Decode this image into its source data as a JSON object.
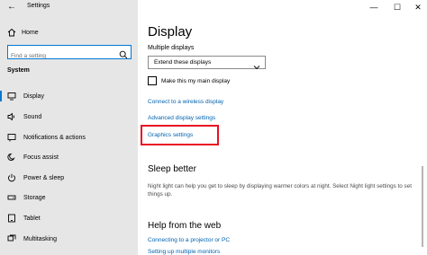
{
  "window": {
    "title": "Settings",
    "back_glyph": "←",
    "minimize_glyph": "—",
    "maximize_glyph": "☐",
    "close_glyph": "✕"
  },
  "sidebar": {
    "home_label": "Home",
    "search_placeholder": "Find a setting",
    "section_label": "System",
    "items": [
      {
        "label": "Display",
        "icon": "display-icon",
        "active": true
      },
      {
        "label": "Sound",
        "icon": "sound-icon"
      },
      {
        "label": "Notifications & actions",
        "icon": "notifications-icon"
      },
      {
        "label": "Focus assist",
        "icon": "focus-assist-icon"
      },
      {
        "label": "Power & sleep",
        "icon": "power-icon"
      },
      {
        "label": "Storage",
        "icon": "storage-icon"
      },
      {
        "label": "Tablet",
        "icon": "tablet-icon"
      },
      {
        "label": "Multitasking",
        "icon": "multitasking-icon"
      }
    ]
  },
  "main": {
    "title": "Display",
    "multiple_displays_label": "Multiple displays",
    "multiple_displays_value": "Extend these displays",
    "main_display_checkbox_label": "Make this my main display",
    "links": {
      "wireless": "Connect to a wireless display",
      "advanced": "Advanced display settings",
      "graphics": "Graphics settings"
    },
    "sleep_better": {
      "heading": "Sleep better",
      "text": "Night light can help you get to sleep by displaying warmer colors at night. Select Night light settings to set things up."
    },
    "help": {
      "heading": "Help from the web",
      "links": [
        "Connecting to a projector or PC",
        "Setting up multiple monitors"
      ]
    }
  },
  "colors": {
    "accent": "#0078d7",
    "link": "#0063b1",
    "highlight": "#e81123",
    "sidebar_bg": "#e6e6e6"
  }
}
